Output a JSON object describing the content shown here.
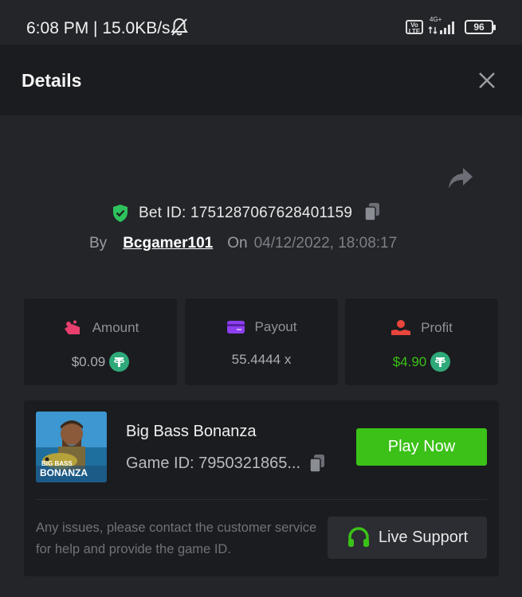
{
  "status_bar": {
    "time_text": "6:08 PM | 15.0KB/s",
    "volte": "Vo\nLTE",
    "network": "4G+",
    "battery": "96"
  },
  "header": {
    "title": "Details"
  },
  "bet": {
    "bet_id_label": "Bet ID: 1751287067628401159",
    "by_label": "By",
    "username": "Bcgamer101",
    "on_label": "On",
    "date": "04/12/2022, 18:08:17"
  },
  "stats": [
    {
      "label": "Amount",
      "value": "$0.09",
      "icon": "amount-icon",
      "color": "#a9acb2"
    },
    {
      "label": "Payout",
      "value": "55.4444 x",
      "icon": "payout-icon",
      "color": "#a9acb2"
    },
    {
      "label": "Profit",
      "value": "$4.90",
      "icon": "profit-icon",
      "color": "#3bc117"
    }
  ],
  "game": {
    "name": "Big Bass Bonanza",
    "game_id": "Game ID: 7950321865...",
    "thumb_line1": "BIG BASS",
    "thumb_line2": "BONANZA",
    "play_label": "Play Now"
  },
  "support": {
    "message": "Any issues, please contact the customer service for help and provide the game ID.",
    "button_label": "Live Support"
  },
  "colors": {
    "accent_green": "#3bc117",
    "verified_green": "#2ec25d",
    "tether": "#2ea97a"
  }
}
